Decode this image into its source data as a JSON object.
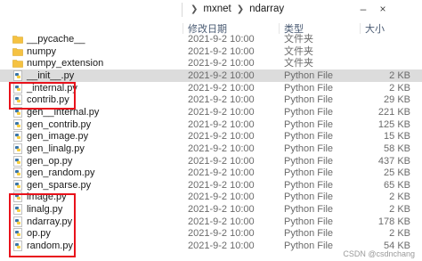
{
  "window": {
    "breadcrumb": [
      "mxnet",
      "ndarray"
    ],
    "minimize_label": "–",
    "close_label": "×"
  },
  "columns": {
    "date": "修改日期",
    "type": "类型",
    "size": "大小"
  },
  "files": [
    {
      "name": "__pycache__",
      "date": "2021-9-2 10:00",
      "type": "文件夹",
      "size": "",
      "icon": "folder-icon"
    },
    {
      "name": "numpy",
      "date": "2021-9-2 10:00",
      "type": "文件夹",
      "size": "",
      "icon": "folder-icon"
    },
    {
      "name": "numpy_extension",
      "date": "2021-9-2 10:00",
      "type": "文件夹",
      "size": "",
      "icon": "folder-icon"
    },
    {
      "name": "__init__.py",
      "date": "2021-9-2 10:00",
      "type": "Python File",
      "size": "2 KB",
      "icon": "python-file-icon",
      "selected": true
    },
    {
      "name": "_internal.py",
      "date": "2021-9-2 10:00",
      "type": "Python File",
      "size": "2 KB",
      "icon": "python-file-icon"
    },
    {
      "name": "contrib.py",
      "date": "2021-9-2 10:00",
      "type": "Python File",
      "size": "29 KB",
      "icon": "python-file-icon"
    },
    {
      "name": "gen__internal.py",
      "date": "2021-9-2 10:00",
      "type": "Python File",
      "size": "221 KB",
      "icon": "python-file-icon"
    },
    {
      "name": "gen_contrib.py",
      "date": "2021-9-2 10:00",
      "type": "Python File",
      "size": "125 KB",
      "icon": "python-file-icon"
    },
    {
      "name": "gen_image.py",
      "date": "2021-9-2 10:00",
      "type": "Python File",
      "size": "15 KB",
      "icon": "python-file-icon"
    },
    {
      "name": "gen_linalg.py",
      "date": "2021-9-2 10:00",
      "type": "Python File",
      "size": "58 KB",
      "icon": "python-file-icon"
    },
    {
      "name": "gen_op.py",
      "date": "2021-9-2 10:00",
      "type": "Python File",
      "size": "437 KB",
      "icon": "python-file-icon"
    },
    {
      "name": "gen_random.py",
      "date": "2021-9-2 10:00",
      "type": "Python File",
      "size": "25 KB",
      "icon": "python-file-icon"
    },
    {
      "name": "gen_sparse.py",
      "date": "2021-9-2 10:00",
      "type": "Python File",
      "size": "65 KB",
      "icon": "python-file-icon"
    },
    {
      "name": "image.py",
      "date": "2021-9-2 10:00",
      "type": "Python File",
      "size": "2 KB",
      "icon": "python-file-icon"
    },
    {
      "name": "linalg.py",
      "date": "2021-9-2 10:00",
      "type": "Python File",
      "size": "2 KB",
      "icon": "python-file-icon"
    },
    {
      "name": "ndarray.py",
      "date": "2021-9-2 10:00",
      "type": "Python File",
      "size": "178 KB",
      "icon": "python-file-icon"
    },
    {
      "name": "op.py",
      "date": "2021-9-2 10:00",
      "type": "Python File",
      "size": "2 KB",
      "icon": "python-file-icon"
    },
    {
      "name": "random.py",
      "date": "2021-9-2 10:00",
      "type": "Python File",
      "size": "54 KB",
      "icon": "python-file-icon"
    }
  ],
  "watermark": "CSDN @csdnchang",
  "colors": {
    "highlight_box": "#e8121b",
    "folder": "#f5c242",
    "python_blue": "#3774a8",
    "python_yellow": "#f7cf3f"
  }
}
